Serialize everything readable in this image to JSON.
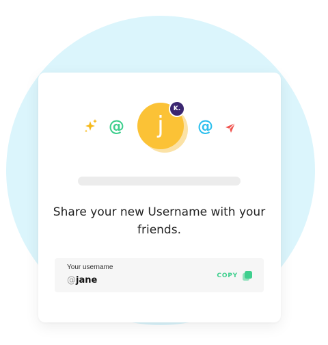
{
  "avatar": {
    "letter": "j",
    "badge": "K."
  },
  "decor": {
    "at_symbol": "@"
  },
  "share": {
    "message": "Share your new Username with your friends."
  },
  "username": {
    "label": "Your username",
    "prefix": "@",
    "value": "jane"
  },
  "copy": {
    "label": "COPY"
  },
  "colors": {
    "background_circle": "#dbf5fc",
    "avatar": "#fbc236",
    "badge": "#3b2670",
    "green_accent": "#3fcf8e",
    "blue_accent": "#2fc0ee",
    "sparkle": "#f6b91a",
    "send": "#f0544f"
  },
  "icons": [
    "sparkle-icon",
    "at-icon",
    "send-icon",
    "copy-icon"
  ]
}
